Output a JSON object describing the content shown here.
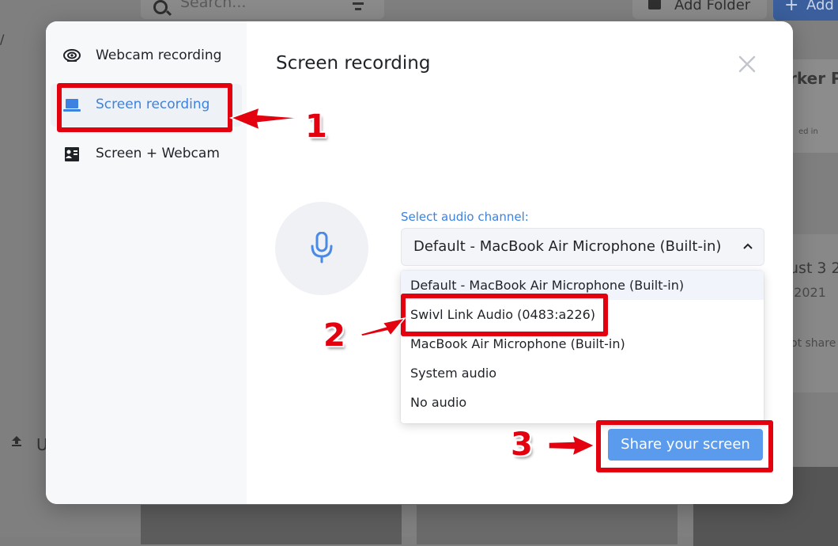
{
  "background": {
    "search_placeholder": "Search...",
    "add_folder_label": "Add Folder",
    "add_button_label": "Add",
    "left_fragment": "/",
    "upload_fragment": "U",
    "card_text_a": "rker P",
    "card_text_b": "ed in",
    "card_text_c": "ust 3 2",
    "card_text_d": ", 2021",
    "card_text_e": "ot share"
  },
  "modal": {
    "title": "Screen recording",
    "sidebar": {
      "items": [
        {
          "label": "Webcam recording",
          "icon": "webcam-icon",
          "active": false
        },
        {
          "label": "Screen recording",
          "icon": "laptop-icon",
          "active": true
        },
        {
          "label": "Screen + Webcam",
          "icon": "screen-webcam-icon",
          "active": false
        }
      ]
    },
    "audio": {
      "label": "Select audio channel:",
      "selected": "Default - MacBook Air Microphone (Built-in)",
      "options": [
        "Default - MacBook Air Microphone (Built-in)",
        "Swivl Link Audio (0483:a226)",
        "MacBook Air Microphone (Built-in)",
        "System audio",
        "No audio"
      ]
    },
    "share_button": "Share your screen"
  },
  "annotations": {
    "steps": [
      "1",
      "2",
      "3"
    ],
    "color": "#e3000f"
  },
  "colors": {
    "accent": "#3d82e0",
    "button": "#5b9bee",
    "sidebar_bg": "#f7f8fa"
  }
}
